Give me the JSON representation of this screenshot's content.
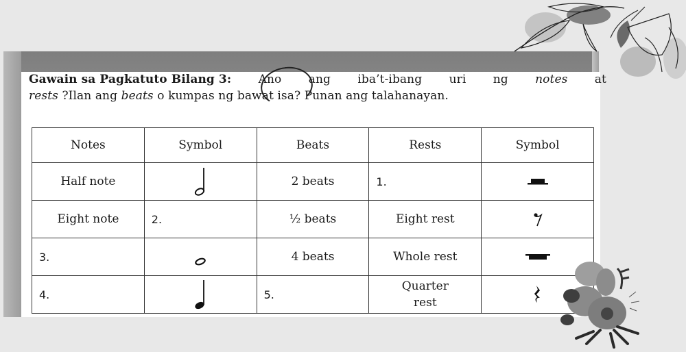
{
  "instructions": {
    "title_bold": "Gawain sa Pagkatuto Bilang 3:",
    "line1_rest": [
      "Ano",
      "ang",
      "iba’t-ibang",
      "uri",
      "ng"
    ],
    "notes_italic": "notes",
    "line1_end": "at",
    "rests_italic": "rests",
    "line2_a": " ?Ilan ang ",
    "beats_italic": "beats",
    "line2_b": " o kumpas ng bawat isa? Punan ang talahanayan."
  },
  "table": {
    "headers": [
      "Notes",
      "Symbol",
      "Beats",
      "Rests",
      "Symbol"
    ],
    "rows": [
      {
        "note": "Half note",
        "note_symbol": "half-note",
        "beats": "2 beats",
        "rest": "1.",
        "rest_symbol": "half-rest"
      },
      {
        "note": "Eight note",
        "note_symbol": "2.",
        "beats": "½ beats",
        "rest": "Eight rest",
        "rest_symbol": "eighth-rest"
      },
      {
        "note": "3.",
        "note_symbol": "whole-note",
        "beats": "4 beats",
        "rest": "Whole rest",
        "rest_symbol": "whole-rest"
      },
      {
        "note": "4.",
        "note_symbol": "quarter-note",
        "beats": "5.",
        "rest_line1": "Quarter",
        "rest_line2": "rest",
        "rest_symbol": "quarter-rest"
      }
    ]
  },
  "colors": {
    "background": "#e8e8e8",
    "frame": "#8e8e8e",
    "paper": "#ffffff",
    "ink": "#1a1a1a"
  }
}
